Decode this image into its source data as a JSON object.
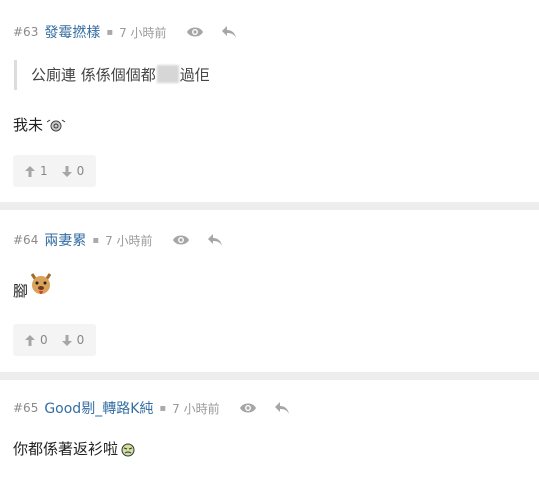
{
  "posts": [
    {
      "floor": "#63",
      "user": "發霉撚樣",
      "time": "7 小時前",
      "quote_prefix": "公廁連 係係個個都",
      "quote_suffix": "過佢",
      "content": "我未",
      "up": "1",
      "down": "0"
    },
    {
      "floor": "#64",
      "user": "兩妻累",
      "time": "7 小時前",
      "content": "腳",
      "up": "0",
      "down": "0"
    },
    {
      "floor": "#65",
      "user": "Good剔_轉路K純",
      "time": "7 小時前",
      "content": "你都係著返衫啦"
    }
  ],
  "icons": {
    "view": "eye-icon",
    "reply": "reply-icon",
    "up": "arrow-up-icon",
    "down": "arrow-down-icon"
  },
  "colors": {
    "username": "#356ea3",
    "background": "#ededed",
    "card": "#ffffff"
  }
}
